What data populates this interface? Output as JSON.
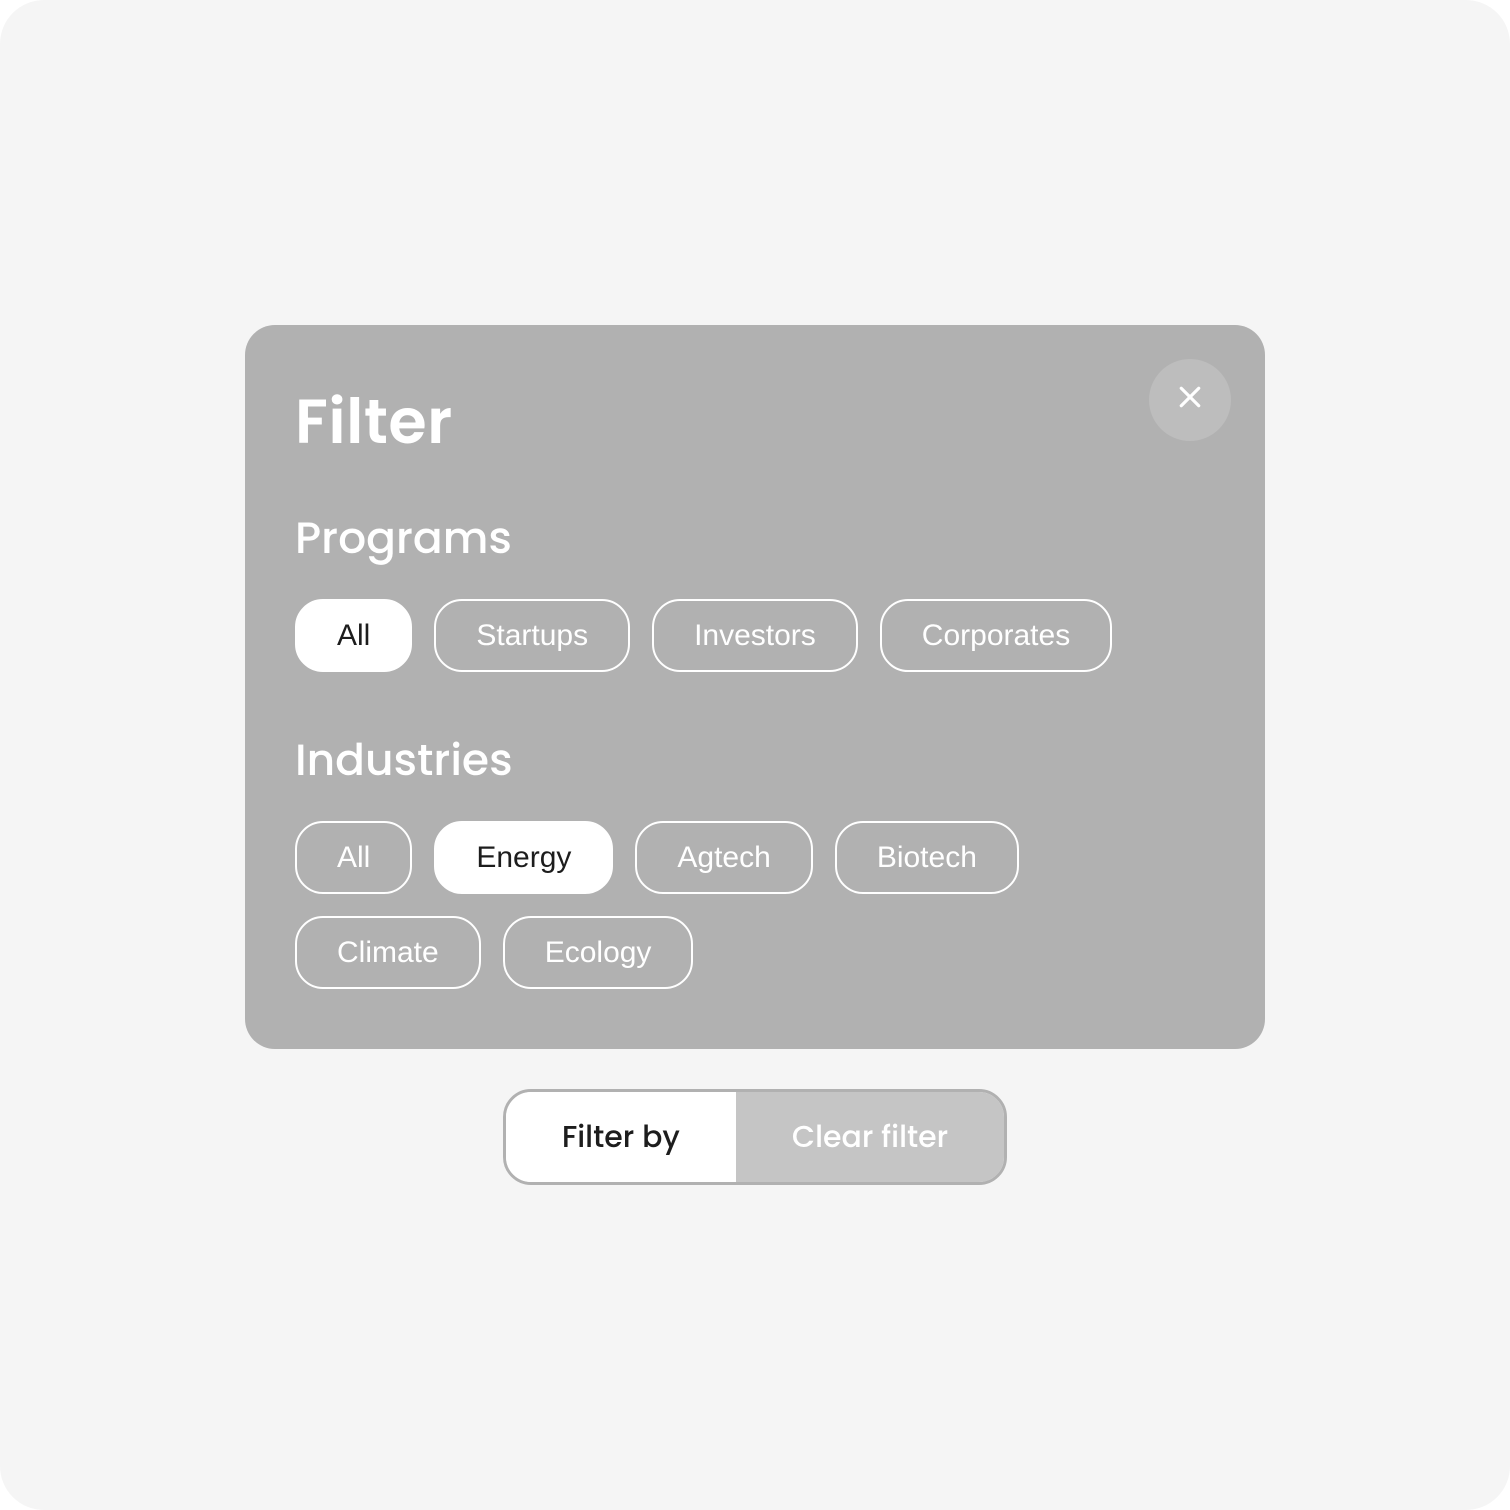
{
  "panel": {
    "title": "Filter",
    "close_icon": "close-icon"
  },
  "sections": {
    "programs": {
      "heading": "Programs",
      "chips": [
        {
          "label": "All",
          "selected": true
        },
        {
          "label": "Startups",
          "selected": false
        },
        {
          "label": "Investors",
          "selected": false
        },
        {
          "label": "Corporates",
          "selected": false
        }
      ]
    },
    "industries": {
      "heading": "Industries",
      "chips": [
        {
          "label": "All",
          "selected": false
        },
        {
          "label": "Energy",
          "selected": true
        },
        {
          "label": "Agtech",
          "selected": false
        },
        {
          "label": "Biotech",
          "selected": false
        },
        {
          "label": "Climate",
          "selected": false
        },
        {
          "label": "Ecology",
          "selected": false
        }
      ]
    }
  },
  "actions": {
    "filter_by": "Filter by",
    "clear_filter": "Clear filter"
  },
  "colors": {
    "panel_bg": "#b1b1b1",
    "frame_bg": "#f5f5f5",
    "chip_selected_bg": "#ffffff",
    "chip_selected_fg": "#1d1d1d",
    "close_bg": "#bdbdbd",
    "secondary_btn_bg": "#c5c5c5"
  }
}
